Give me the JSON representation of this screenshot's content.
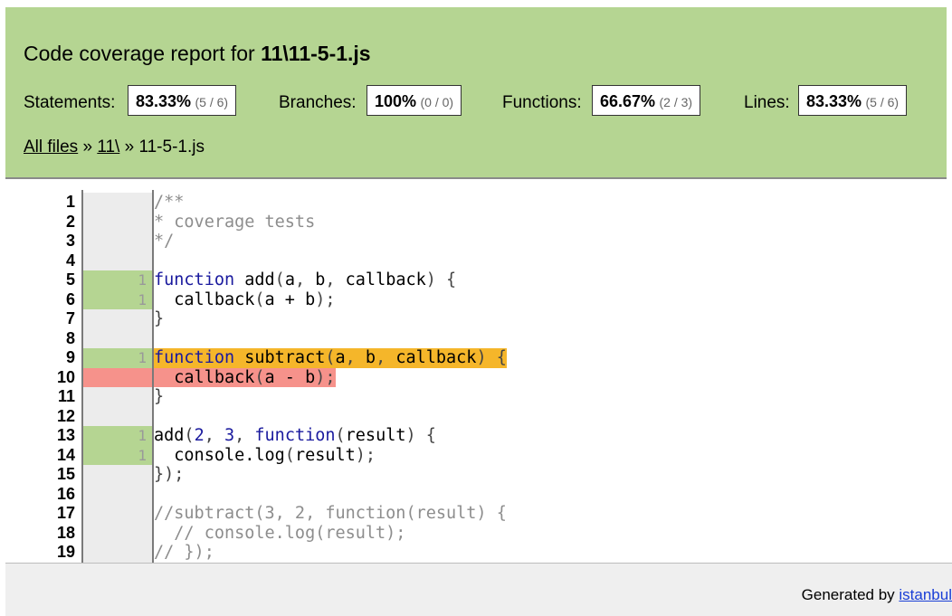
{
  "header": {
    "title_prefix": "Code coverage report for ",
    "title_file": "11\\11-5-1.js",
    "metrics": [
      {
        "label": "Statements:",
        "pct": "83.33%",
        "frac": "(5 / 6)"
      },
      {
        "label": "Branches:",
        "pct": "100%",
        "frac": "(0 / 0)"
      },
      {
        "label": "Functions:",
        "pct": "66.67%",
        "frac": "(2 / 3)"
      },
      {
        "label": "Lines:",
        "pct": "83.33%",
        "frac": "(5 / 6)"
      }
    ],
    "breadcrumb": {
      "all_files": "All files",
      "sep1": " » ",
      "folder": "11\\",
      "sep2": " » ",
      "file": "11-5-1.js"
    }
  },
  "code_lines": [
    {
      "n": "1",
      "count": "",
      "text": "/**"
    },
    {
      "n": "2",
      "count": "",
      "text": "* coverage tests"
    },
    {
      "n": "3",
      "count": "",
      "text": "*/"
    },
    {
      "n": "4",
      "count": "",
      "text": ""
    },
    {
      "n": "5",
      "count": "1",
      "text": "function add(a, b, callback) {"
    },
    {
      "n": "6",
      "count": "1",
      "text": "  callback(a + b);"
    },
    {
      "n": "7",
      "count": "",
      "text": "}"
    },
    {
      "n": "8",
      "count": "",
      "text": ""
    },
    {
      "n": "9",
      "count": "1",
      "text": "function subtract(a, b, callback) {"
    },
    {
      "n": "10",
      "count": "",
      "text": "  callback(a - b);"
    },
    {
      "n": "11",
      "count": "",
      "text": "}"
    },
    {
      "n": "12",
      "count": "",
      "text": ""
    },
    {
      "n": "13",
      "count": "1",
      "text": "add(2, 3, function(result) {"
    },
    {
      "n": "14",
      "count": "1",
      "text": "  console.log(result);"
    },
    {
      "n": "15",
      "count": "",
      "text": "});"
    },
    {
      "n": "16",
      "count": "",
      "text": ""
    },
    {
      "n": "17",
      "count": "",
      "text": "//subtract(3, 2, function(result) {"
    },
    {
      "n": "18",
      "count": "",
      "text": "  // console.log(result);"
    },
    {
      "n": "19",
      "count": "",
      "text": "// });"
    }
  ],
  "colors": {
    "header_bg": "#b5d592",
    "covered": "#b5d592",
    "uncovered": "#f6928b",
    "function_not_covered": "#f5b62a",
    "gutter": "#ececec"
  },
  "footer": {
    "generated_by": "Generated by ",
    "link": "istanbul"
  }
}
